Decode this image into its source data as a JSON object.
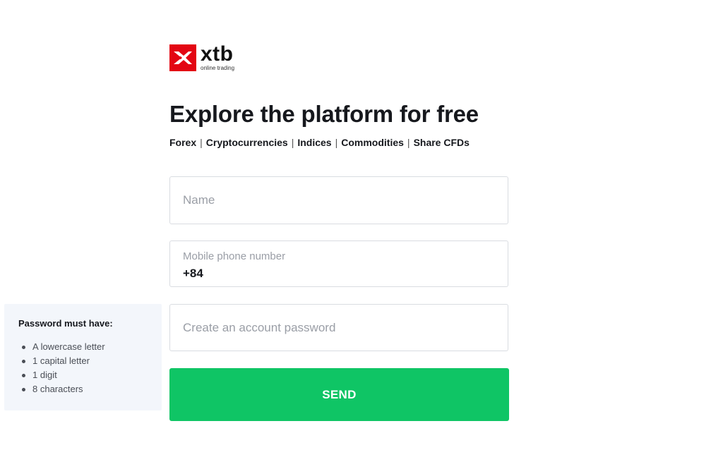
{
  "logo": {
    "word": "xtb",
    "tagline": "online trading",
    "brand_color": "#e30613",
    "icon": "xtb-x-mark"
  },
  "headline": "Explore the platform for free",
  "categories": [
    "Forex",
    "Cryptocurrencies",
    "Indices",
    "Commodities",
    "Share CFDs"
  ],
  "categories_separator": "|",
  "form": {
    "name_placeholder": "Name",
    "phone_label": "Mobile phone number",
    "phone_value": "+84",
    "password_placeholder": "Create an account password",
    "send_label": "SEND",
    "send_color": "#0fc565"
  },
  "password_rules": {
    "title": "Password must have:",
    "items": [
      "A lowercase letter",
      "1 capital letter",
      "1 digit",
      "8 characters"
    ]
  }
}
